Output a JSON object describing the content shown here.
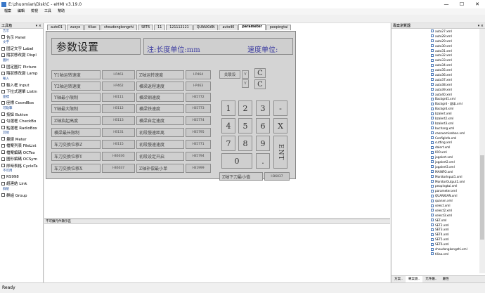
{
  "window": {
    "title": "E:\\zhuomian\\Disk\\C - eHMI v3.19.0",
    "minimize": "—",
    "maximize": "☐",
    "close": "✕"
  },
  "menu": [
    "檔案",
    "編輯",
    "檢視",
    "工具",
    "幫助"
  ],
  "toolbox": {
    "title": "工具箱",
    "pin": "▾ ×",
    "groups": [
      {
        "category": "告示",
        "items": [
          "告示 Panel"
        ]
      },
      {
        "category": "文字",
        "items": [
          "固定文字 Label",
          "隨狀態改變 Displ"
        ]
      },
      {
        "category": "圖片",
        "items": [
          "固定圖片 Picture",
          "隨狀態改變 Lamp"
        ]
      },
      {
        "category": "輸入",
        "items": [
          "輸入框 Input",
          "下拉式選單 Listin"
        ]
      },
      {
        "category": "座標",
        "items": [
          "座標 CoordBox"
        ]
      },
      {
        "category": "可點擊",
        "items": [
          "按鈕 Button",
          "勾選框 CheckBo",
          "點選框 RadioBox"
        ]
      },
      {
        "category": "其他",
        "items": [
          "量錶 Meter",
          "檔案列表 FileList",
          "檔案編碼 OCTex",
          "圖形編碼 OCSym",
          "即時表格 CycleTa"
        ]
      },
      {
        "category": "不可用",
        "items": [
          "RS998",
          "超連結 Link"
        ]
      },
      {
        "category": "群組",
        "items": [
          "群組 Group"
        ]
      }
    ]
  },
  "tabs": [
    "auto01",
    "zuoye",
    "tiliao",
    "shoudongkongzhi",
    "SET6",
    "11",
    "121112121",
    "QUANXIAN",
    "auto40",
    "parameter",
    "peopingtai"
  ],
  "active_tab": "parameter",
  "screen": {
    "title": "参数设置",
    "unit_length": "注:长度单位:mm",
    "unit_speed": "速度单位:",
    "left_rows": [
      {
        "label": "Y1轴运转速度",
        "addr": "I-P461"
      },
      {
        "label": "Y2轴运转速度",
        "addr": "I-P462"
      },
      {
        "label": "Y轴最小限制",
        "addr": "I-B111"
      },
      {
        "label": "Y轴最大限制",
        "addr": "I-B112"
      },
      {
        "label": "Z轴抬起高度",
        "addr": "I-B113"
      },
      {
        "label": "横梁最长限制",
        "addr": "I-B131"
      },
      {
        "label": "车刀交换位移Z",
        "addr": "I-B115"
      },
      {
        "label": "车刀交换位移Y",
        "addr": "I-B6036"
      },
      {
        "label": "车刀交换位移X",
        "addr": "I-B6037"
      }
    ],
    "right_rows": [
      {
        "label": "Z轴运转速度",
        "addr": "I-P464"
      },
      {
        "label": "横梁返程速度",
        "addr": "I-P463"
      },
      {
        "label": "横梁钢速度",
        "addr": "I-B5772"
      },
      {
        "label": "横梁铁速度",
        "addr": "I-B5773"
      },
      {
        "label": "横梁自定速度",
        "addr": "I-B5774"
      },
      {
        "label": "初段慢速距离",
        "addr": "I-B5795"
      },
      {
        "label": "初段慢速速度",
        "addr": "I-B5771"
      },
      {
        "label": "初段设定开启",
        "addr": "I-B5794"
      },
      {
        "label": "Z轴补偿最小单",
        "addr": "I-B1999"
      }
    ],
    "link_label": "关联设",
    "link_y1": "Y",
    "link_y2": "Y",
    "link_c1": "C",
    "link_c2": "C",
    "keypad": {
      "k1": "1",
      "k2": "2",
      "k3": "3",
      "k4": "4",
      "k5": "5",
      "k6": "6",
      "k7": "7",
      "k8": "8",
      "k9": "9",
      "k0": "0",
      "dot": ".",
      "minus": "-",
      "clear": "X",
      "enter": "ENT"
    },
    "z_min_label": "Z轴下刀最小值",
    "z_min_addr": "I-B6037"
  },
  "status_panel": {
    "title": "不可擴元件顯示區"
  },
  "explorer": {
    "title": "專案瀏覽器",
    "pin": "▾ ×",
    "files": [
      "auto27.xml",
      "auto28.xml",
      "auto29.xml",
      "auto30.xml",
      "auto31.xml",
      "auto32.xml",
      "auto33.xml",
      "auto34.xml",
      "auto35.xml",
      "auto36.xml",
      "auto37.xml",
      "auto38.xml",
      "auto39.xml",
      "auto40.xml",
      "Backgrd1.xml",
      "Backgrd - 副本.xml",
      "Backgrd.xml",
      "bzalert.xml",
      "bzalert2.xml",
      "bzalert3.xml",
      "buchang.xml",
      "caozuomianban.xml",
      "ConfigInfo.xml",
      "cutting.xml",
      "dalert.xml",
      "IOO.xml",
      "jogalert.xml",
      "jogalert2.xml",
      "jogalert3.xml",
      "MAINFO.xml",
      "MonitorInput1.xml",
      "MonitorOutput1.xml",
      "peopingtai.xml",
      "parameter.xml",
      "QUANXIAN.xml",
      "quanxn.xml",
      "select.xml",
      "select2.xml",
      "select3.xml",
      "SET.xml",
      "SET2.xml",
      "SET3.xml",
      "SET4.xml",
      "SET5.xml",
      "SET6.xml",
      "shoudongkongzhi.xml",
      "tiliao.xml"
    ],
    "tabs": [
      "方案..",
      "專案瀏..",
      "元件屬..",
      "屬性"
    ]
  },
  "statusbar": {
    "text": "Ready"
  }
}
